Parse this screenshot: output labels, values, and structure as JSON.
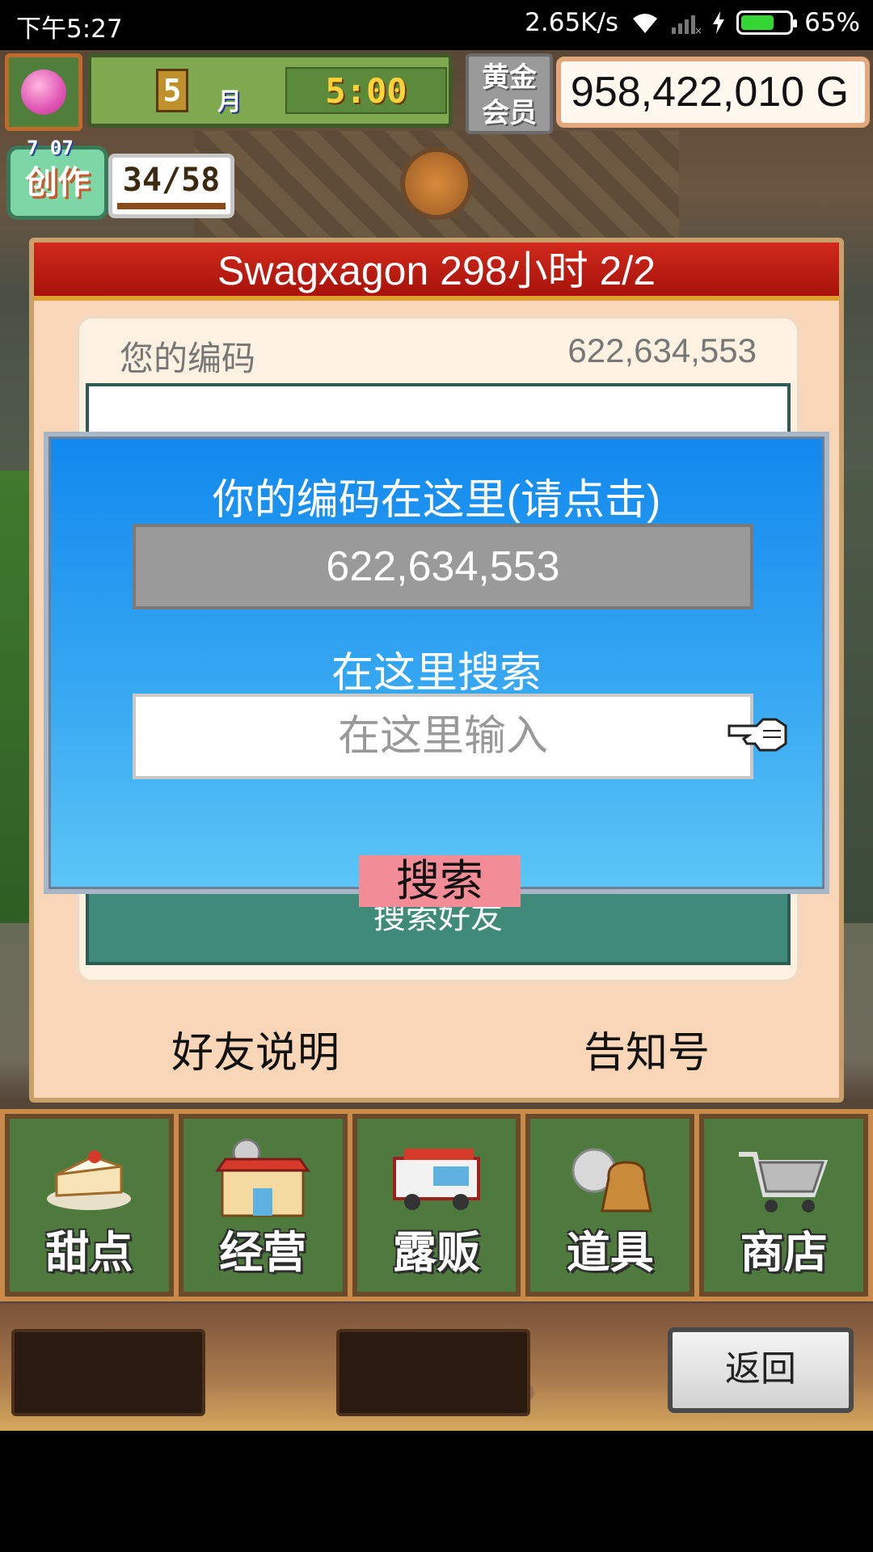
{
  "status_bar": {
    "time": "下午5:27",
    "net_speed": "2.65K/s",
    "battery": "65%"
  },
  "hud": {
    "month_number": "5",
    "month_label": "月",
    "clock": "5:00",
    "gold_member_label": "黄金会员",
    "money": "958,422,010 G",
    "create_label": "创作",
    "create_top": "7 07",
    "create_count": "34/58"
  },
  "panel": {
    "title": "Swagxagon  298小时 2/2",
    "your_code_label": "您的编码",
    "your_code_value": "622,634,553",
    "search_friend": "搜索好友",
    "friend_explain": "好友说明",
    "notice_id": "告知号"
  },
  "dialog": {
    "title": "你的编码在这里(请点击)",
    "code": "622,634,553",
    "search_heading": "在这里搜索",
    "input_placeholder": "在这里输入",
    "search_button": "搜索"
  },
  "nav": {
    "items": [
      {
        "label": "甜点",
        "icon": "cake-icon"
      },
      {
        "label": "经营",
        "icon": "shop-icon"
      },
      {
        "label": "露贩",
        "icon": "food-truck-icon"
      },
      {
        "label": "道具",
        "icon": "items-bag-icon"
      },
      {
        "label": "商店",
        "icon": "shopping-cart-icon"
      }
    ]
  },
  "footer": {
    "back": "返回"
  }
}
